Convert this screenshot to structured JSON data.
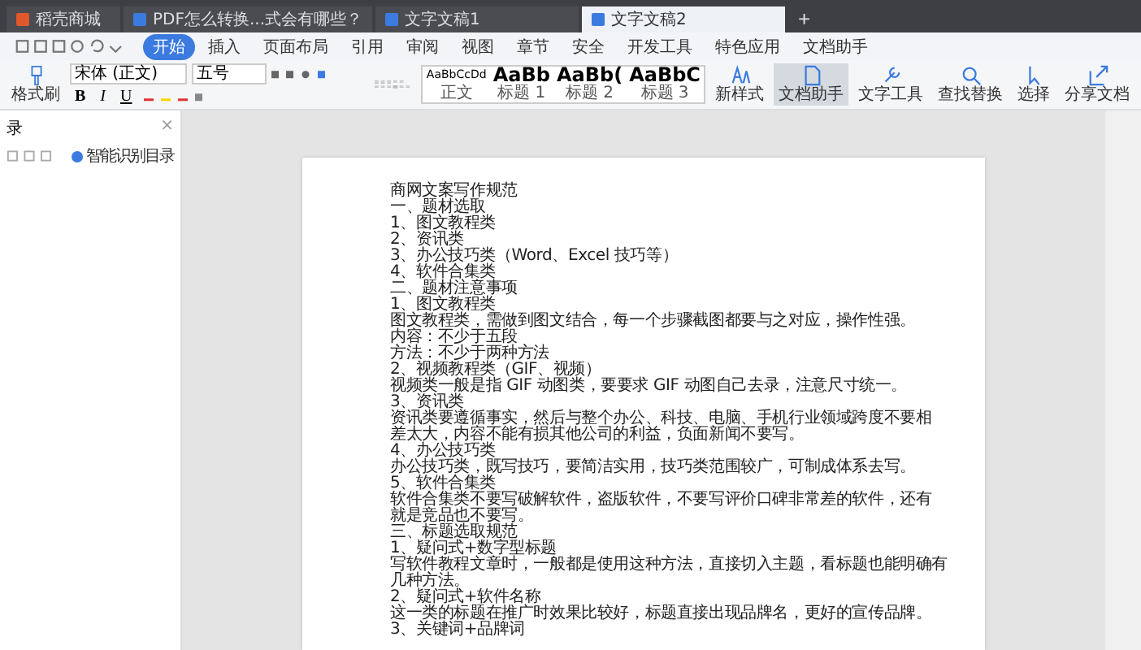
{
  "tabs": [
    {
      "label": "稻壳商城",
      "selected": false
    },
    {
      "label": "PDF怎么转换...式会有哪些？",
      "selected": false
    },
    {
      "label": "文字文稿1",
      "selected": false
    },
    {
      "label": "文字文稿2",
      "selected": true
    }
  ],
  "new_tab": "+",
  "menu": [
    {
      "label": "开始",
      "selected": true
    },
    {
      "label": "插入",
      "selected": false
    },
    {
      "label": "页面布局",
      "selected": false
    },
    {
      "label": "引用",
      "selected": false
    },
    {
      "label": "审阅",
      "selected": false
    },
    {
      "label": "视图",
      "selected": false
    },
    {
      "label": "章节",
      "selected": false
    },
    {
      "label": "安全",
      "selected": false
    },
    {
      "label": "开发工具",
      "selected": false
    },
    {
      "label": "特色应用",
      "selected": false
    },
    {
      "label": "文档助手",
      "selected": false
    }
  ],
  "ribbon": {
    "format_painter": "格式刷",
    "font_name": "宋体 (正文)",
    "font_size": "五号",
    "format_buttons": [
      "B",
      "I",
      "U"
    ],
    "styles": [
      {
        "sample": "AaBbCcDd",
        "label": "正文"
      },
      {
        "sample": "AaBb",
        "label": "标题 1"
      },
      {
        "sample": "AaBb(",
        "label": "标题 2"
      },
      {
        "sample": "AaBbC",
        "label": "标题 3"
      }
    ],
    "tools": [
      {
        "label": "新样式",
        "selected": false
      },
      {
        "label": "文档助手",
        "selected": true
      },
      {
        "label": "文字工具",
        "selected": false
      },
      {
        "label": "查找替换",
        "selected": false
      },
      {
        "label": "选择",
        "selected": false
      },
      {
        "label": "分享文档",
        "selected": false
      }
    ]
  },
  "nav_pane": {
    "title": "录",
    "close": "×",
    "smart_toc": "智能识别目录"
  },
  "document": {
    "lines": [
      "商网文案写作规范",
      "一、题材选取",
      "1、图文教程类",
      "2、资讯类",
      "3、办公技巧类（Word、Excel 技巧等）",
      "4、软件合集类",
      "二、题材注意事项",
      "1、图文教程类",
      "图文教程类，需做到图文结合，每一个步骤截图都要与之对应，操作性强。",
      "内容：不少于五段",
      "方法：不少于两种方法",
      "2、视频教程类（GIF、视频）",
      "视频类一般是指 GIF 动图类，要要求 GIF 动图自己去录，注意尺寸统一。",
      "3、资讯类",
      "资讯类要遵循事实，然后与整个办公、科技、电脑、手机行业领域跨度不要相",
      "差太大，内容不能有损其他公司的利益，负面新闻不要写。",
      "4、办公技巧类",
      "办公技巧类，既写技巧，要简洁实用，技巧类范围较广，可制成体系去写。",
      "5、软件合集类",
      "软件合集类不要写破解软件，盗版软件，不要写评价口碑非常差的软件，还有",
      "就是竞品也不要写。",
      "三、标题选取规范",
      "1、疑问式+数字型标题",
      "写软件教程文章时，一般都是使用这种方法，直接切入主题，看标题也能明确有",
      "几种方法。",
      "2、疑问式+软件名称",
      "这一类的标题在推广时效果比较好，标题直接出现品牌名，更好的宣传品牌。",
      "3、关键词+品牌词"
    ]
  }
}
